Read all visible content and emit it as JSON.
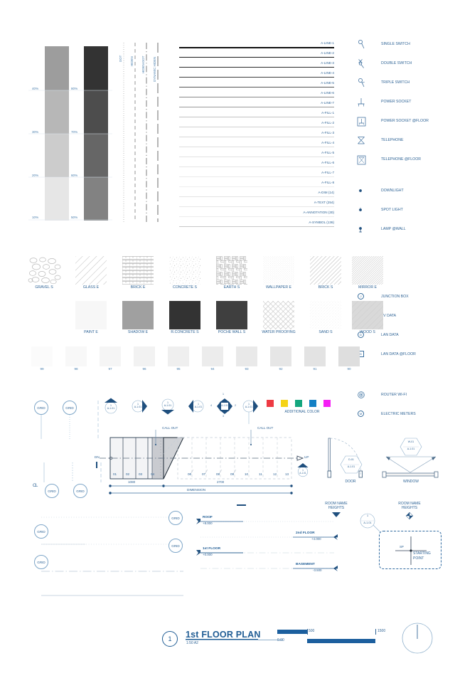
{
  "sheet": {
    "title": "1st FLOOR PLAN",
    "title_number": "1",
    "scale": "1:50 A2"
  },
  "grayscale_bars": {
    "left_bar": {
      "steps": [
        {
          "label": "40%",
          "color": "#9d9d9d"
        },
        {
          "label": "30%",
          "color": "#b7b7b7"
        },
        {
          "label": "20%",
          "color": "#cccccc"
        },
        {
          "label": "10%",
          "color": "#e6e6e6"
        }
      ]
    },
    "right_bar": {
      "steps": [
        {
          "label": "80%",
          "color": "#333333"
        },
        {
          "label": "70%",
          "color": "#4d4d4d"
        },
        {
          "label": "60%",
          "color": "#666666"
        },
        {
          "label": "50%",
          "color": "#828282"
        }
      ]
    }
  },
  "line_patterns": [
    {
      "name": "DOT",
      "style": "dotted"
    },
    {
      "name": "HIDEN",
      "style": "dashed"
    },
    {
      "name": "HIDEN-DOT",
      "style": "dash-dot"
    },
    {
      "name": "DYNAMIC HIDEN",
      "style": "long-dash"
    }
  ],
  "line_weights": [
    {
      "label": "A-LINE-1",
      "weight": 1.6,
      "color": "#111111"
    },
    {
      "label": "A-LINE-2",
      "weight": 1.3,
      "color": "#1c1c1c"
    },
    {
      "label": "A-LINE-3",
      "weight": 1.0,
      "color": "#2b2b2b"
    },
    {
      "label": "A-LINE-4",
      "weight": 0.85,
      "color": "#3d3d3d"
    },
    {
      "label": "A-LINE-5",
      "weight": 0.7,
      "color": "#555555"
    },
    {
      "label": "A-LINE-6",
      "weight": 0.55,
      "color": "#8a8a8a"
    },
    {
      "label": "A-LINE-7",
      "weight": 0.45,
      "color": "#9a9a9a"
    },
    {
      "label": "A-FILL-1",
      "weight": 0.4,
      "color": "#c2c2c2"
    },
    {
      "label": "A-FILL-2",
      "weight": 0.4,
      "color": "#d0d0d0"
    },
    {
      "label": "A-FILL-3",
      "weight": 0.4,
      "color": "#d8d8d8"
    },
    {
      "label": "A-FILL-4",
      "weight": 0.4,
      "color": "#dedede"
    },
    {
      "label": "A-FILL-5",
      "weight": 0.4,
      "color": "#e2e2e2"
    },
    {
      "label": "A-FILL-6",
      "weight": 0.4,
      "color": "#e6e6e6"
    },
    {
      "label": "A-FILL-7",
      "weight": 0.4,
      "color": "#ebebeb"
    },
    {
      "label": "A-FILL-8",
      "weight": 0.4,
      "color": "#efefef"
    },
    {
      "label": "A-DIM (14)",
      "weight": 0.4,
      "color": "#e3e3e3"
    },
    {
      "label": "A-TEXT (254)",
      "weight": 0.4,
      "color": "#e8e8e8"
    },
    {
      "label": "A-ANNOTATION (30)",
      "weight": 0.4,
      "color": "#ededed"
    },
    {
      "label": "A-SYMBOL (136)",
      "weight": 0.5,
      "color": "#c8c8c8"
    }
  ],
  "electrical_symbols": [
    {
      "icon": "single-switch-icon",
      "label": "SINGLE SWITCH"
    },
    {
      "icon": "double-switch-icon",
      "label": "DOUBLE SWITCH"
    },
    {
      "icon": "triple-switch-icon",
      "label": "TRIPLE SWITCH"
    },
    {
      "icon": "power-socket-icon",
      "label": "POWER SOCKET"
    },
    {
      "icon": "power-socket-floor-icon",
      "label": "POWER SOCKET @FLOOR"
    },
    {
      "icon": "telephone-icon",
      "label": "TELEPHONE"
    },
    {
      "icon": "telephone-floor-icon",
      "label": "TELEPHONE @FLOOR"
    }
  ],
  "lighting_symbols": [
    {
      "icon": "downlight-icon",
      "label": "DOWNLIGHT"
    },
    {
      "icon": "spot-light-icon",
      "label": "SPOT LIGHT"
    },
    {
      "icon": "lamp-wall-icon",
      "label": "LAMP @WALL"
    }
  ],
  "data_symbols": [
    {
      "icon": "junction-box-icon",
      "badge": "J",
      "shape": "circle",
      "label": "JUNCTION BOX"
    },
    {
      "icon": "tv-data-icon",
      "badge": "TV",
      "shape": "circle",
      "label": "TV DATA"
    },
    {
      "icon": "lan-data-icon",
      "badge": "D",
      "shape": "circle",
      "label": "LAN DATA"
    },
    {
      "icon": "lan-data-floor-icon",
      "badge": "D",
      "shape": "square",
      "label": "LAN DATA @FLOOR"
    }
  ],
  "network_symbols": [
    {
      "icon": "router-wifi-icon",
      "badge": "",
      "shape": "circle",
      "label": "ROUTER WI-FI"
    },
    {
      "icon": "electric-meters-icon",
      "badge": "M",
      "shape": "circle",
      "label": "ELECTRIC METERS"
    }
  ],
  "hatches_row1": [
    {
      "name": "GRAVEL S",
      "pattern": "gravel"
    },
    {
      "name": "GLASS E",
      "pattern": "diag-sparse"
    },
    {
      "name": "BRICK E",
      "pattern": "brick"
    },
    {
      "name": "CONCRETE S",
      "pattern": "speckle"
    },
    {
      "name": "EARTH S",
      "pattern": "basket"
    },
    {
      "name": "WALLPAPER E",
      "pattern": "dots-fine"
    },
    {
      "name": "BRICK S",
      "pattern": "diag-medium"
    },
    {
      "name": "MIRROR E",
      "pattern": "diag-dense"
    }
  ],
  "hatches_row2": [
    {
      "name": "PAINT E",
      "pattern": "solid",
      "color": "#f7f7f7"
    },
    {
      "name": "SHADOW E",
      "pattern": "solid",
      "color": "#a0a0a0"
    },
    {
      "name": "R.CONCRETE S",
      "pattern": "solid",
      "color": "#333333"
    },
    {
      "name": "POCHE WALL S",
      "pattern": "solid",
      "color": "#3f3f3f"
    },
    {
      "name": "WATER PROOFING",
      "pattern": "crosshatch"
    },
    {
      "name": "SAND S",
      "pattern": "sand"
    },
    {
      "name": "WOOD S",
      "pattern": "wood"
    }
  ],
  "gray_swatches": [
    {
      "label": "99",
      "color": "#fbfbfb"
    },
    {
      "label": "98",
      "color": "#f8f8f8"
    },
    {
      "label": "97",
      "color": "#f5f5f5"
    },
    {
      "label": "96",
      "color": "#f2f2f2"
    },
    {
      "label": "95",
      "color": "#efefef"
    },
    {
      "label": "94",
      "color": "#ececec"
    },
    {
      "label": "93",
      "color": "#e9e9e9"
    },
    {
      "label": "92",
      "color": "#e6e6e6"
    },
    {
      "label": "91",
      "color": "#e3e3e3"
    },
    {
      "label": "90",
      "color": "#dedede"
    }
  ],
  "additional_colors": {
    "label": "ADDITIONAL COLOR",
    "swatches": [
      "#ee3a43",
      "#f5d316",
      "#13a67e",
      "#1380c4",
      "#f51ff5"
    ]
  },
  "callout_markers": {
    "number": "1",
    "sheet_ref": "A-1.01",
    "four_way": {
      "left": "4",
      "right": "2",
      "top": "1",
      "bottom": "3"
    },
    "items": [
      {
        "direction": "up"
      },
      {
        "direction": "right"
      },
      {
        "direction": "down"
      },
      {
        "direction": "left"
      },
      {
        "direction": "all"
      },
      {
        "direction": "right2"
      }
    ]
  },
  "grid_bubbles": {
    "label": "GRID",
    "center_line_label": "CL"
  },
  "plan_detail": {
    "call_out_left": "CALL OUT",
    "call_out_right": "CALL OUT",
    "dn_label": "DN",
    "up_label": "UP",
    "stair_numbers_left": [
      "01",
      "02",
      "03",
      "04"
    ],
    "stair_numbers_right": [
      "06",
      "07",
      "08",
      "09",
      "10",
      "11",
      "12",
      "13"
    ],
    "dim_left": "1080",
    "dim_right": "2700",
    "dim_label": "DIMENSION",
    "callout_number": "1",
    "callout_ref": "A-1.01"
  },
  "openings": [
    {
      "name": "DOOR",
      "tag": "D-01",
      "ref": "A-1.01"
    },
    {
      "name": "WINDOW",
      "tag": "W-01",
      "ref": "A-1.01"
    }
  ],
  "levels": [
    {
      "name": "ROOF",
      "elevation": "+8.000",
      "side": "left"
    },
    {
      "name": "2nd FLOOR",
      "elevation": "+4.000",
      "side": "right"
    },
    {
      "name": "1st FLOOR",
      "elevation": "+0.000",
      "side": "left"
    },
    {
      "name": "BASEMENT",
      "elevation": "-3.500",
      "side": "right"
    }
  ],
  "room_name_heights": {
    "label_line1": "ROOM NAME",
    "label_line2": "HEIGHTS"
  },
  "starting_point": {
    "abbr": "SP",
    "label_line1": "STARTING",
    "label_line2": "POINT",
    "callout_number": "1",
    "callout_ref": "A-1.01"
  },
  "scale_bar": {
    "zero": "0.00",
    "mid": "500",
    "end": "1500",
    "color": "#1c5f9e"
  },
  "accent_color": "#1f5c94",
  "text_color": "#2f6496"
}
